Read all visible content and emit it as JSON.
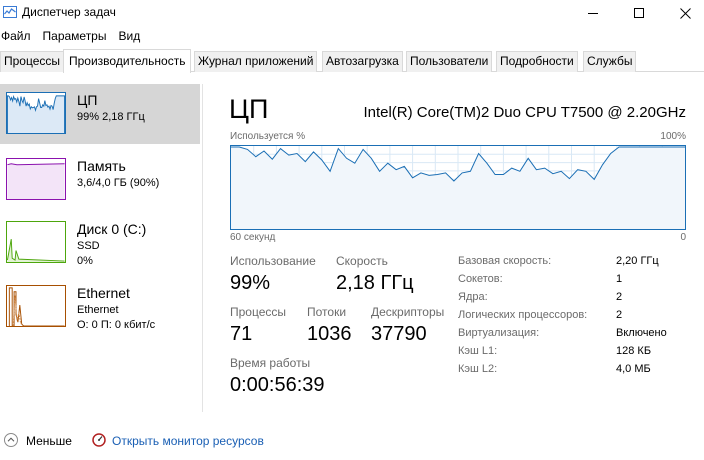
{
  "window": {
    "title": "Диспетчер задач"
  },
  "menu": [
    "Файл",
    "Параметры",
    "Вид"
  ],
  "tabs": [
    "Процессы",
    "Производительность",
    "Журнал приложений",
    "Автозагрузка",
    "Пользователи",
    "Подробности",
    "Службы"
  ],
  "active_tab": "Производительность",
  "sidebar": [
    {
      "name": "ЦП",
      "sub1": "99% 2,18 ГГц",
      "sub2": "",
      "selected": true,
      "color": "#1b6fb5"
    },
    {
      "name": "Память",
      "sub1": "3,6/4,0 ГБ (90%)",
      "sub2": "",
      "selected": false,
      "color": "#8b12ae"
    },
    {
      "name": "Диск 0 (C:)",
      "sub1": "SSD",
      "sub2": "0%",
      "selected": false,
      "color": "#4da60c"
    },
    {
      "name": "Ethernet",
      "sub1": "Ethernet",
      "sub2": "О: 0 П: 0 кбит/с",
      "selected": false,
      "color": "#a74f01"
    }
  ],
  "main": {
    "title": "ЦП",
    "model": "Intel(R) Core(TM)2 Duo CPU T7500 @ 2.20GHz",
    "graph_label": "Используется %",
    "graph_max": "100%",
    "graph_time": "60 секунд",
    "graph_min": "0",
    "accent": "#1b6fb5",
    "usage_series": [
      100,
      100,
      97,
      88,
      95,
      85,
      98,
      90,
      92,
      82,
      94,
      84,
      70,
      98,
      86,
      80,
      97,
      86,
      70,
      80,
      72,
      76,
      62,
      68,
      65,
      66,
      68,
      58,
      68,
      70,
      92,
      80,
      66,
      66,
      74,
      70,
      86,
      72,
      74,
      67,
      70,
      61,
      72,
      70,
      60,
      78,
      92,
      100,
      100,
      100,
      100,
      100,
      100,
      100,
      100,
      100
    ]
  },
  "stats": {
    "usage_label": "Использование",
    "usage_value": "99%",
    "speed_label": "Скорость",
    "speed_value": "2,18 ГГц",
    "proc_label": "Процессы",
    "proc_value": "71",
    "threads_label": "Потоки",
    "threads_value": "1036",
    "handles_label": "Дескрипторы",
    "handles_value": "37790",
    "uptime_label": "Время работы",
    "uptime_value": "0:00:56:39"
  },
  "specs": [
    {
      "key": "Базовая скорость:",
      "value": "2,20 ГГц"
    },
    {
      "key": "Сокетов:",
      "value": "1"
    },
    {
      "key": "Ядра:",
      "value": "2"
    },
    {
      "key": "Логических процессоров:",
      "value": "2"
    },
    {
      "key": "Виртуализация:",
      "value": "Включено"
    },
    {
      "key": "Кэш L1:",
      "value": "128 КБ"
    },
    {
      "key": "Кэш L2:",
      "value": "4,0 МБ"
    }
  ],
  "footer": {
    "fewer": "Меньше",
    "monitor_link": "Открыть монитор ресурсов"
  }
}
